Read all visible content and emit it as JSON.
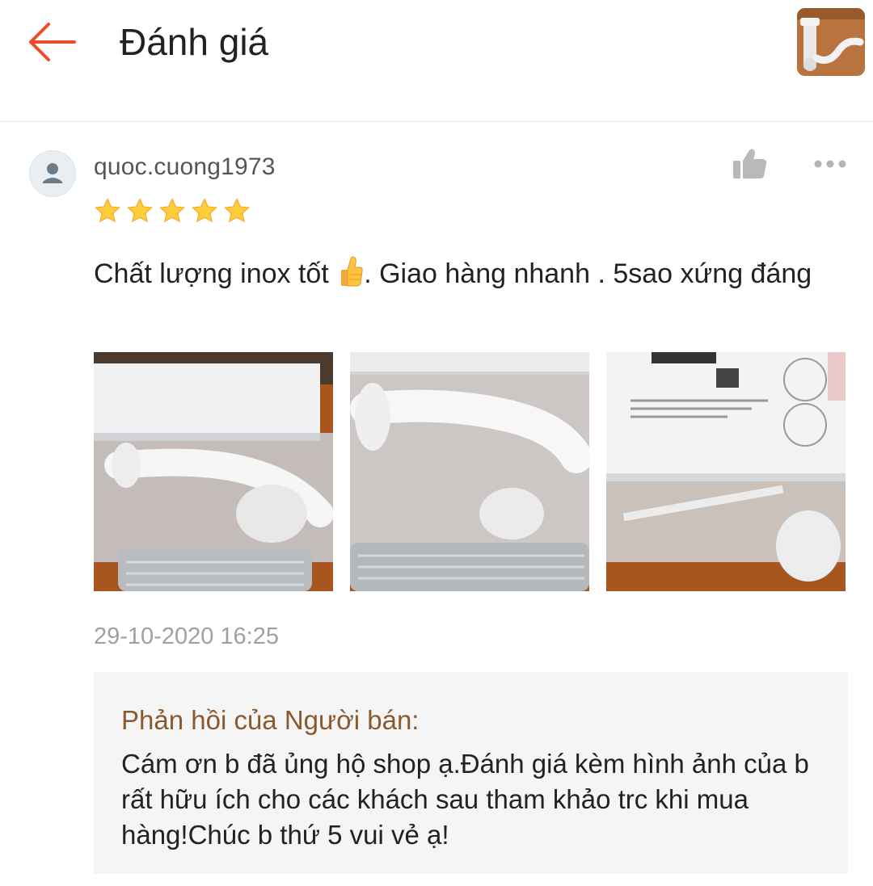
{
  "header": {
    "title": "Đánh giá",
    "back_icon": "arrow-left-icon",
    "accent_color": "#ee4d2d"
  },
  "review": {
    "username": "quoc.cuong1973",
    "rating": 5,
    "rating_max": 5,
    "star_color": "#ffce3d",
    "text_before_emoji": "Chất lượng inox tốt ",
    "emoji": "👍",
    "text_after_emoji": ". Giao hàng nhanh . 5sao xứng đáng",
    "photo_count": 3,
    "timestamp": "29-10-2020 16:25",
    "icons": [
      "avatar-icon",
      "thumbs-up-icon",
      "more-icon"
    ]
  },
  "seller_reply": {
    "title": "Phản hồi của Người bán:",
    "text": "Cám ơn b đã ủng hộ shop ạ.Đánh giá kèm hình ảnh của b rất hữu ích cho các khách sau tham khảo trc khi mua hàng!Chúc b thứ 5 vui vẻ ạ!",
    "title_color": "#8a5a2c"
  }
}
